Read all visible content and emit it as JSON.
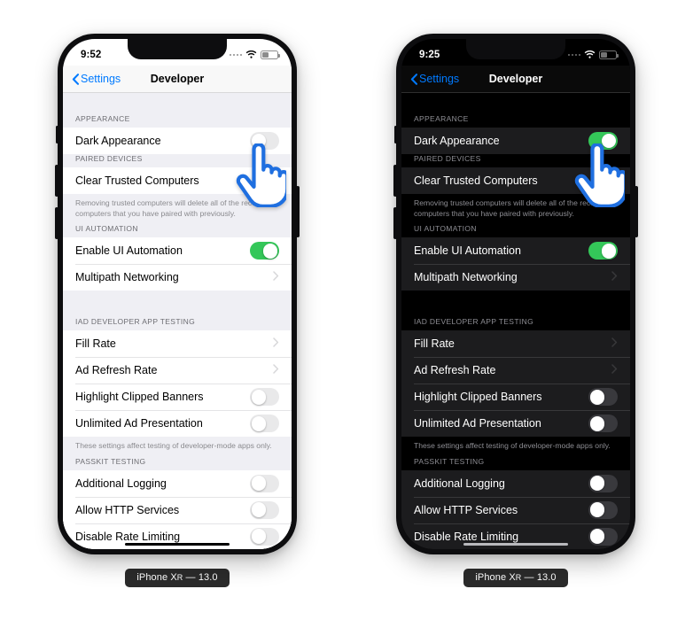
{
  "background": "#ffffff",
  "accent_blue": "#007aff",
  "link_blue": "#3a83f7",
  "toggle_green": "#34c759",
  "cursor_color": "#1f6fe0",
  "devices": [
    {
      "id": "left-light",
      "theme": "light",
      "caption_prefix": "iPhone X",
      "caption_smallcap": "R",
      "caption_suffix": " — 13.0",
      "status": {
        "time": "9:52",
        "signal_icon": "signal-dots-icon",
        "wifi_icon": "wifi-icon",
        "battery_icon": "battery-icon",
        "battery_level": "40%"
      },
      "nav": {
        "back_label": "Settings",
        "back_icon": "chevron-left-icon",
        "title": "Developer"
      },
      "sections": [
        {
          "header": "APPEARANCE",
          "rows": [
            {
              "label": "Dark Appearance",
              "control": "toggle",
              "value": "off"
            }
          ]
        },
        {
          "header": "PAIRED DEVICES",
          "rows": [
            {
              "label": "Clear Trusted Computers",
              "control": "link"
            }
          ],
          "footer": "Removing trusted computers will delete all of the records of computers that you have paired with previously."
        },
        {
          "header": "UI AUTOMATION",
          "rows": [
            {
              "label": "Enable UI Automation",
              "control": "toggle",
              "value": "on"
            },
            {
              "label": "Multipath Networking",
              "control": "disclosure"
            }
          ]
        },
        {
          "header": "IAD DEVELOPER APP TESTING",
          "rows": [
            {
              "label": "Fill Rate",
              "control": "disclosure"
            },
            {
              "label": "Ad Refresh Rate",
              "control": "disclosure"
            },
            {
              "label": "Highlight Clipped Banners",
              "control": "toggle",
              "value": "off"
            },
            {
              "label": "Unlimited Ad Presentation",
              "control": "toggle",
              "value": "off"
            }
          ],
          "footer": "These settings affect testing of developer-mode apps only."
        },
        {
          "header": "PASSKIT TESTING",
          "rows": [
            {
              "label": "Additional Logging",
              "control": "toggle",
              "value": "off"
            },
            {
              "label": "Allow HTTP Services",
              "control": "toggle",
              "value": "off"
            },
            {
              "label": "Disable Rate Limiting",
              "control": "toggle",
              "value": "off"
            }
          ]
        }
      ]
    },
    {
      "id": "right-dark",
      "theme": "dark",
      "caption_prefix": "iPhone X",
      "caption_smallcap": "R",
      "caption_suffix": " — 13.0",
      "status": {
        "time": "9:25",
        "signal_icon": "signal-dots-icon",
        "wifi_icon": "wifi-icon",
        "battery_icon": "battery-icon",
        "battery_level": "40%"
      },
      "nav": {
        "back_label": "Settings",
        "back_icon": "chevron-left-icon",
        "title": "Developer"
      },
      "sections": [
        {
          "header": "APPEARANCE",
          "rows": [
            {
              "label": "Dark Appearance",
              "control": "toggle",
              "value": "on"
            }
          ]
        },
        {
          "header": "PAIRED DEVICES",
          "rows": [
            {
              "label": "Clear Trusted Computers",
              "control": "link"
            }
          ],
          "footer": "Removing trusted computers will delete all of the records of computers that you have paired with previously."
        },
        {
          "header": "UI AUTOMATION",
          "rows": [
            {
              "label": "Enable UI Automation",
              "control": "toggle",
              "value": "on"
            },
            {
              "label": "Multipath Networking",
              "control": "disclosure"
            }
          ]
        },
        {
          "header": "IAD DEVELOPER APP TESTING",
          "rows": [
            {
              "label": "Fill Rate",
              "control": "disclosure"
            },
            {
              "label": "Ad Refresh Rate",
              "control": "disclosure"
            },
            {
              "label": "Highlight Clipped Banners",
              "control": "toggle",
              "value": "off"
            },
            {
              "label": "Unlimited Ad Presentation",
              "control": "toggle",
              "value": "off"
            }
          ],
          "footer": "These settings affect testing of developer-mode apps only."
        },
        {
          "header": "PASSKIT TESTING",
          "rows": [
            {
              "label": "Additional Logging",
              "control": "toggle",
              "value": "off"
            },
            {
              "label": "Allow HTTP Services",
              "control": "toggle",
              "value": "off"
            },
            {
              "label": "Disable Rate Limiting",
              "control": "toggle",
              "value": "off"
            }
          ]
        }
      ]
    }
  ]
}
